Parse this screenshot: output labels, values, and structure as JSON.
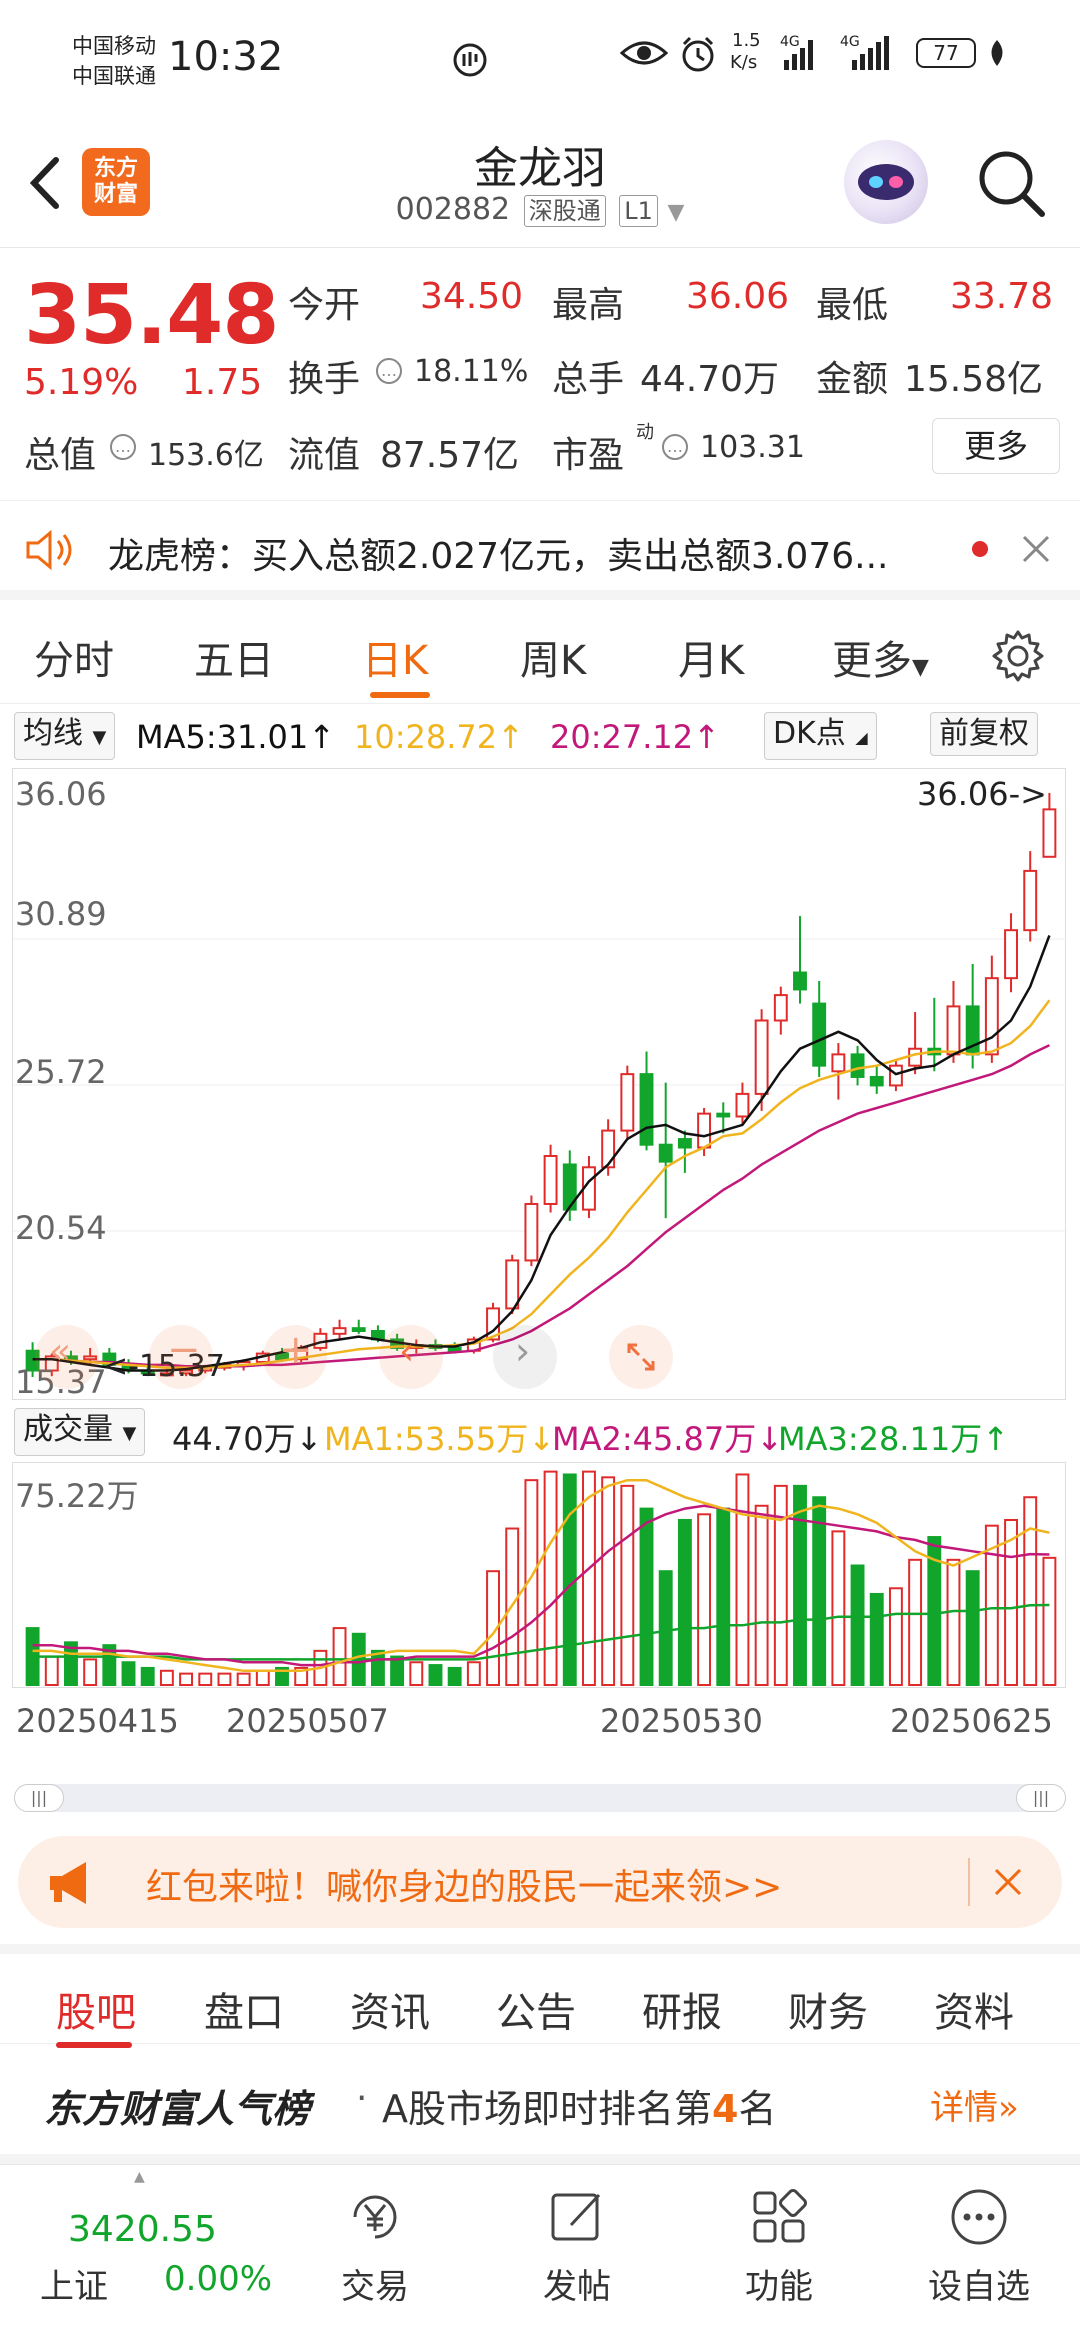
{
  "status": {
    "carrier1": "中国移动",
    "carrier2": "中国联通",
    "time": "10:32",
    "net_speed_top": "1.5",
    "net_speed_bottom": "K/s",
    "battery": "77"
  },
  "header": {
    "logo_line1": "东方",
    "logo_line2": "财富",
    "name": "金龙羽",
    "code": "002882",
    "tag1": "深股通",
    "tag2": "L1"
  },
  "quote": {
    "price": "35.48",
    "change_pct": "5.19%",
    "change_val": "1.75",
    "open_label": "今开",
    "open": "34.50",
    "high_label": "最高",
    "high": "36.06",
    "low_label": "最低",
    "low": "33.78",
    "turnover_label": "换手",
    "turnover": "18.11%",
    "volume_label": "总手",
    "volume": "44.70万",
    "amount_label": "金额",
    "amount": "15.58亿",
    "mktcap_label": "总值",
    "mktcap": "153.6亿",
    "float_label": "流值",
    "float": "87.57亿",
    "pe_label": "市盈",
    "pe_sup": "动",
    "pe": "103.31",
    "more": "更多"
  },
  "dragon": {
    "text": "龙虎榜：买入总额2.027亿元，卖出总额3.076..."
  },
  "period_tabs": [
    "分时",
    "五日",
    "日K",
    "周K",
    "月K",
    "更多"
  ],
  "ma": {
    "selector": "均线",
    "ma5": "MA5:31.01↑",
    "ma10": "10:28.72↑",
    "ma20": "20:27.12↑",
    "dk": "DK点",
    "adjust": "前复权"
  },
  "axis": {
    "y_top": "36.06",
    "y2": "30.89",
    "y3": "25.72",
    "y4": "20.54",
    "y_bottom": "15.37",
    "high_marker": "36.06->",
    "low_marker": "<-15.37"
  },
  "volume": {
    "selector": "成交量",
    "current": "44.70万↓",
    "ma1": "MA1:53.55万↓",
    "ma2": "MA2:45.87万↓",
    "ma3": "MA3:28.11万↑",
    "y_top": "75.22万"
  },
  "dates": [
    "20250415",
    "20250507",
    "20250530",
    "20250625"
  ],
  "colors": {
    "up": "#e02b2b",
    "down": "#11a52c",
    "ma5": "#111111",
    "ma10": "#f0b41e",
    "ma20": "#c2187a",
    "accent": "#f06a12"
  },
  "banner": {
    "text": "红包来啦！喊你身边的股民一起来领>>"
  },
  "info_tabs": [
    "股吧",
    "盘口",
    "资讯",
    "公告",
    "研报",
    "财务",
    "资料"
  ],
  "rank": {
    "title": "东方财富人气榜",
    "pre": "A股市场即时排名第",
    "num": "4",
    "post": "名",
    "detail": "详情"
  },
  "bottom": {
    "index_value": "3420.55",
    "index_name": "上证",
    "index_change": "0.00%",
    "nav": [
      "交易",
      "发帖",
      "功能",
      "设自选"
    ]
  },
  "chart_data": {
    "type": "candlestick",
    "title": "",
    "ylim": [
      15.37,
      36.06
    ],
    "x_start": "20250415",
    "x_end": "20250627",
    "candles": [
      {
        "o": 16.3,
        "h": 16.6,
        "l": 15.37,
        "c": 15.6
      },
      {
        "o": 15.6,
        "h": 16.2,
        "l": 15.4,
        "c": 16.1
      },
      {
        "o": 16.1,
        "h": 16.3,
        "l": 15.8,
        "c": 16.0
      },
      {
        "o": 16.0,
        "h": 16.4,
        "l": 15.8,
        "c": 16.1
      },
      {
        "o": 16.2,
        "h": 16.4,
        "l": 15.7,
        "c": 15.8
      },
      {
        "o": 15.8,
        "h": 16.0,
        "l": 15.5,
        "c": 15.6
      },
      {
        "o": 15.6,
        "h": 15.8,
        "l": 15.4,
        "c": 15.5
      },
      {
        "o": 15.5,
        "h": 15.7,
        "l": 15.4,
        "c": 15.5
      },
      {
        "o": 15.5,
        "h": 15.7,
        "l": 15.4,
        "c": 15.6
      },
      {
        "o": 15.6,
        "h": 15.8,
        "l": 15.5,
        "c": 15.7
      },
      {
        "o": 15.7,
        "h": 15.9,
        "l": 15.6,
        "c": 15.8
      },
      {
        "o": 15.8,
        "h": 16.0,
        "l": 15.6,
        "c": 15.9
      },
      {
        "o": 15.9,
        "h": 16.3,
        "l": 15.8,
        "c": 16.2
      },
      {
        "o": 16.2,
        "h": 16.4,
        "l": 15.9,
        "c": 16.0
      },
      {
        "o": 16.0,
        "h": 16.5,
        "l": 15.9,
        "c": 16.4
      },
      {
        "o": 16.4,
        "h": 17.1,
        "l": 16.3,
        "c": 16.9
      },
      {
        "o": 16.9,
        "h": 17.4,
        "l": 16.7,
        "c": 17.1
      },
      {
        "o": 17.1,
        "h": 17.4,
        "l": 16.9,
        "c": 17.0
      },
      {
        "o": 17.0,
        "h": 17.2,
        "l": 16.6,
        "c": 16.7
      },
      {
        "o": 16.7,
        "h": 16.9,
        "l": 16.3,
        "c": 16.4
      },
      {
        "o": 16.4,
        "h": 16.7,
        "l": 16.2,
        "c": 16.5
      },
      {
        "o": 16.5,
        "h": 16.7,
        "l": 16.3,
        "c": 16.4
      },
      {
        "o": 16.4,
        "h": 16.6,
        "l": 16.2,
        "c": 16.3
      },
      {
        "o": 16.3,
        "h": 16.8,
        "l": 16.2,
        "c": 16.7
      },
      {
        "o": 16.7,
        "h": 18.0,
        "l": 16.6,
        "c": 17.8
      },
      {
        "o": 17.8,
        "h": 19.7,
        "l": 17.6,
        "c": 19.5
      },
      {
        "o": 19.5,
        "h": 21.8,
        "l": 19.3,
        "c": 21.5
      },
      {
        "o": 21.5,
        "h": 23.6,
        "l": 21.2,
        "c": 23.2
      },
      {
        "o": 22.9,
        "h": 23.4,
        "l": 20.9,
        "c": 21.3
      },
      {
        "o": 21.3,
        "h": 23.2,
        "l": 21.0,
        "c": 22.8
      },
      {
        "o": 22.8,
        "h": 24.5,
        "l": 22.5,
        "c": 24.1
      },
      {
        "o": 24.1,
        "h": 26.4,
        "l": 23.8,
        "c": 26.1
      },
      {
        "o": 26.1,
        "h": 26.9,
        "l": 23.4,
        "c": 23.6
      },
      {
        "o": 23.6,
        "h": 25.8,
        "l": 21.0,
        "c": 23.0
      },
      {
        "o": 23.8,
        "h": 24.1,
        "l": 22.6,
        "c": 23.5
      },
      {
        "o": 23.5,
        "h": 24.9,
        "l": 23.2,
        "c": 24.7
      },
      {
        "o": 24.7,
        "h": 25.1,
        "l": 24.0,
        "c": 24.6
      },
      {
        "o": 24.6,
        "h": 25.8,
        "l": 24.3,
        "c": 25.4
      },
      {
        "o": 25.4,
        "h": 28.4,
        "l": 24.8,
        "c": 28.0
      },
      {
        "o": 28.0,
        "h": 29.2,
        "l": 27.5,
        "c": 28.9
      },
      {
        "o": 29.7,
        "h": 31.7,
        "l": 28.6,
        "c": 29.1
      },
      {
        "o": 28.6,
        "h": 29.4,
        "l": 26.0,
        "c": 26.4
      },
      {
        "o": 26.2,
        "h": 27.2,
        "l": 25.2,
        "c": 26.8
      },
      {
        "o": 26.8,
        "h": 27.1,
        "l": 25.7,
        "c": 26.0
      },
      {
        "o": 26.0,
        "h": 26.4,
        "l": 25.4,
        "c": 25.7
      },
      {
        "o": 25.7,
        "h": 26.6,
        "l": 25.5,
        "c": 26.4
      },
      {
        "o": 26.4,
        "h": 28.3,
        "l": 26.1,
        "c": 27.0
      },
      {
        "o": 27.0,
        "h": 28.8,
        "l": 26.2,
        "c": 26.8
      },
      {
        "o": 26.8,
        "h": 29.4,
        "l": 26.5,
        "c": 28.5
      },
      {
        "o": 28.5,
        "h": 30.0,
        "l": 26.3,
        "c": 26.8
      },
      {
        "o": 26.8,
        "h": 30.3,
        "l": 26.5,
        "c": 29.5
      },
      {
        "o": 29.5,
        "h": 31.8,
        "l": 29.0,
        "c": 31.2
      },
      {
        "o": 31.2,
        "h": 34.0,
        "l": 30.8,
        "c": 33.3
      },
      {
        "o": 33.8,
        "h": 36.06,
        "l": 33.78,
        "c": 35.48
      }
    ],
    "ma5": [
      16.0,
      16.0,
      15.9,
      15.8,
      15.7,
      15.6,
      15.6,
      15.6,
      15.65,
      15.75,
      15.85,
      15.95,
      16.1,
      16.25,
      16.4,
      16.6,
      16.7,
      16.8,
      16.7,
      16.6,
      16.5,
      16.45,
      16.45,
      16.6,
      17.0,
      17.7,
      18.8,
      20.4,
      21.4,
      22.3,
      22.9,
      23.8,
      24.2,
      24.3,
      24.0,
      23.9,
      24.1,
      24.3,
      25.2,
      26.2,
      27.0,
      27.3,
      27.6,
      27.3,
      26.6,
      26.1,
      26.3,
      26.4,
      26.8,
      27.1,
      27.4,
      28.0,
      29.2,
      31.01
    ],
    "ma10": [
      16.0,
      16.0,
      15.95,
      15.9,
      15.85,
      15.8,
      15.75,
      15.7,
      15.7,
      15.7,
      15.75,
      15.8,
      15.85,
      15.95,
      16.05,
      16.15,
      16.25,
      16.35,
      16.4,
      16.45,
      16.45,
      16.45,
      16.5,
      16.55,
      16.8,
      17.1,
      17.6,
      18.3,
      19.0,
      19.6,
      20.3,
      21.2,
      22.0,
      22.8,
      23.2,
      23.5,
      23.9,
      24.0,
      24.5,
      25.1,
      25.6,
      25.9,
      26.1,
      26.3,
      26.4,
      26.6,
      26.8,
      26.9,
      26.9,
      26.8,
      26.9,
      27.2,
      27.8,
      28.72
    ],
    "ma20": [
      16.0,
      16.0,
      15.95,
      15.9,
      15.9,
      15.85,
      15.8,
      15.8,
      15.75,
      15.75,
      15.75,
      15.75,
      15.8,
      15.8,
      15.85,
      15.9,
      15.95,
      16.0,
      16.05,
      16.1,
      16.15,
      16.2,
      16.25,
      16.3,
      16.5,
      16.7,
      17.0,
      17.4,
      17.8,
      18.3,
      18.8,
      19.3,
      19.9,
      20.5,
      21.0,
      21.5,
      22.0,
      22.4,
      22.9,
      23.3,
      23.7,
      24.1,
      24.4,
      24.7,
      24.9,
      25.1,
      25.3,
      25.5,
      25.7,
      25.9,
      26.1,
      26.4,
      26.8,
      27.12
    ],
    "volume": [
      20,
      10,
      15,
      9,
      14,
      8,
      6,
      5,
      4,
      4,
      4,
      4,
      5,
      6,
      6,
      12,
      20,
      18,
      12,
      10,
      8,
      7,
      6,
      8,
      40,
      55,
      72,
      75,
      74,
      75,
      73,
      70,
      62,
      40,
      58,
      60,
      62,
      74,
      63,
      70,
      70,
      66,
      54,
      42,
      32,
      34,
      44,
      52,
      44,
      40,
      56,
      58,
      66,
      44.7
    ],
    "vol_ylim": [
      0,
      75.22
    ],
    "vol_ma1": [
      12,
      12,
      11,
      11,
      11,
      10,
      10,
      9,
      8,
      7,
      6,
      5,
      5,
      5,
      5,
      6,
      8,
      10,
      11,
      12,
      12,
      12,
      12,
      11,
      18,
      28,
      38,
      50,
      60,
      66,
      70,
      72,
      72,
      69,
      66,
      64,
      62,
      60,
      59,
      58,
      61,
      63,
      62,
      60,
      57,
      52,
      47,
      44,
      42,
      45,
      48,
      51,
      55,
      53.55
    ],
    "vol_ma2": [
      14,
      14,
      13,
      13,
      12,
      12,
      11,
      11,
      10,
      9,
      9,
      8,
      8,
      8,
      7,
      7,
      8,
      8,
      9,
      9,
      10,
      10,
      10,
      10,
      13,
      17,
      22,
      28,
      35,
      41,
      47,
      52,
      57,
      60,
      62,
      63,
      62,
      61,
      60,
      59,
      58,
      57,
      56,
      55,
      54,
      52,
      51,
      49,
      48,
      47,
      46,
      45,
      46,
      45.87
    ],
    "vol_ma3": [
      10,
      10,
      10,
      10,
      10,
      10,
      10,
      10,
      9,
      9,
      9,
      9,
      9,
      9,
      9,
      9,
      9,
      9,
      9,
      9,
      9,
      9,
      9,
      9,
      10,
      11,
      12,
      13,
      14,
      15,
      16,
      17,
      18,
      19,
      20,
      20,
      21,
      21,
      22,
      22,
      23,
      23,
      24,
      24,
      24,
      25,
      25,
      25,
      26,
      26,
      27,
      27,
      28,
      28.11
    ]
  }
}
